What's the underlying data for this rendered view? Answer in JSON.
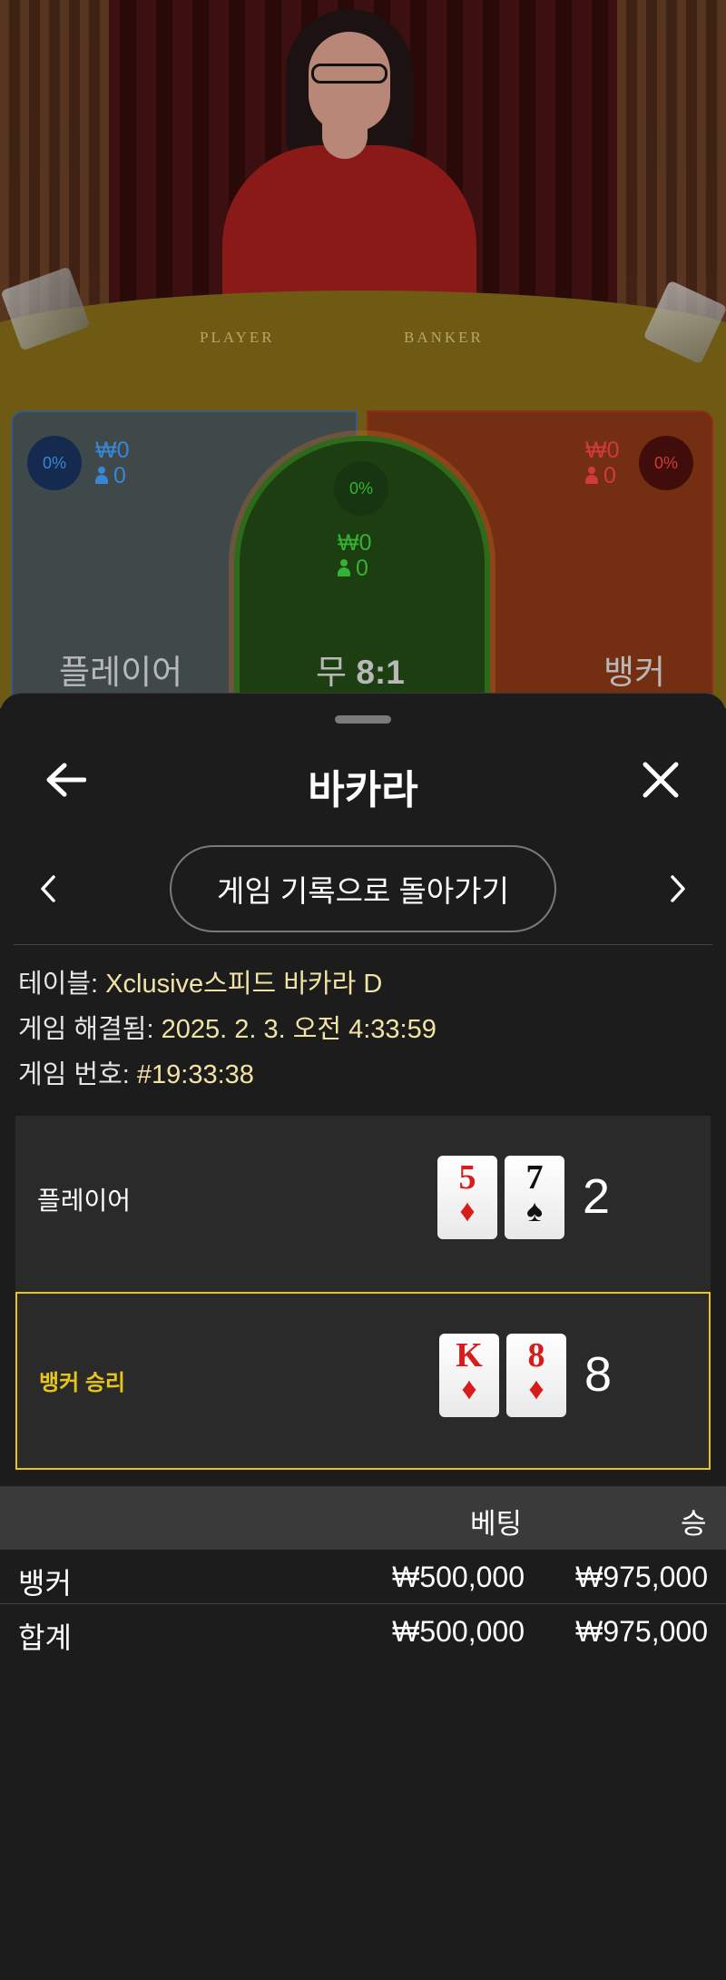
{
  "game_table": {
    "felt_labels": {
      "player": "PLAYER",
      "banker": "BANKER"
    },
    "player": {
      "label": "플레이어",
      "percent": "0%",
      "amount": "₩0",
      "players": "0"
    },
    "tie": {
      "label": "무",
      "payout": "8:1",
      "percent": "0%",
      "amount": "₩0",
      "players": "0"
    },
    "banker": {
      "label": "뱅커",
      "percent": "0%",
      "amount": "₩0",
      "players": "0"
    }
  },
  "sheet": {
    "title": "바카라",
    "history_button": "게임 기록으로 돌아가기",
    "info": {
      "table_label": "테이블:",
      "table_value": "Xclusive스피드 바카라 D",
      "resolved_label": "게임 해결됨:",
      "resolved_value": "2025. 2. 3. 오전 4:33:59",
      "number_label": "게임 번호:",
      "number_value": "#19:33:38"
    },
    "results": {
      "player": {
        "label": "플레이어",
        "cards": [
          {
            "rank": "5",
            "suit": "♦"
          },
          {
            "rank": "7",
            "suit": "♠"
          }
        ],
        "score": "2"
      },
      "banker": {
        "label": "뱅커 승리",
        "cards": [
          {
            "rank": "K",
            "suit": "♦"
          },
          {
            "rank": "8",
            "suit": "♦"
          }
        ],
        "score": "8"
      }
    },
    "bets": {
      "headers": {
        "bet": "베팅",
        "win": "승"
      },
      "rows": [
        {
          "name": "뱅커",
          "bet": "₩500,000",
          "win": "₩975,000"
        },
        {
          "name": "합계",
          "bet": "₩500,000",
          "win": "₩975,000"
        }
      ]
    }
  },
  "colors": {
    "accent_yellow": "#e6c419",
    "info_value": "#f2e3a5",
    "player_blue": "#3a86d6",
    "banker_red": "#d03a3a",
    "tie_green": "#33b233"
  }
}
